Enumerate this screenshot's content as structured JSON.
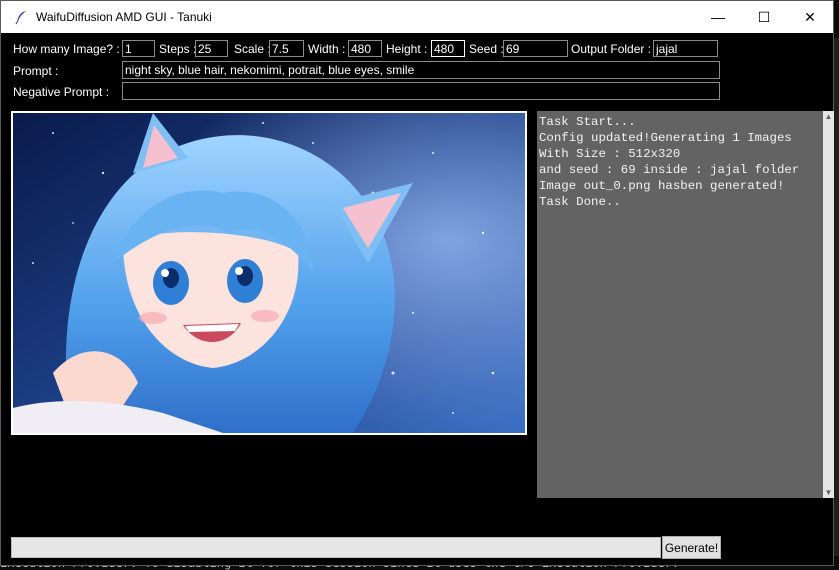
{
  "window": {
    "title": "WaifuDiffusion AMD GUI - Tanuki",
    "controls": {
      "minimize": "—",
      "maximize": "☐",
      "close": "✕"
    }
  },
  "form": {
    "how_many": {
      "label": "How many Image? :",
      "value": "1"
    },
    "steps": {
      "label": "Steps :",
      "value": "25"
    },
    "scale": {
      "label": "Scale :",
      "value": "7.5"
    },
    "width": {
      "label": "Width :",
      "value": "480"
    },
    "height": {
      "label": "Height :",
      "value": "480"
    },
    "seed": {
      "label": "Seed :",
      "value": "69"
    },
    "output_folder": {
      "label": "Output Folder :",
      "value": "jajal"
    },
    "prompt": {
      "label": "Prompt :",
      "value": "night sky, blue hair, nekomimi, potrait, blue eyes, smile"
    },
    "negative_prompt": {
      "label": "Negative Prompt :",
      "value": ""
    }
  },
  "log": {
    "text": "Task Start...\nConfig updated!Generating 1 Images\nWith Size : 512x320\nand seed : 69 inside : jajal folder\nImage out_0.png hasben generated!\nTask Done.."
  },
  "generate_button": "Generate!",
  "background_terminal": {
    "visible_line": "Execution Provider. To disabling it for this session since it uses the CPU Execution Provider."
  },
  "colors": {
    "window_bg": "#000000",
    "log_bg": "#636363",
    "titlebar_bg": "#ffffff"
  }
}
